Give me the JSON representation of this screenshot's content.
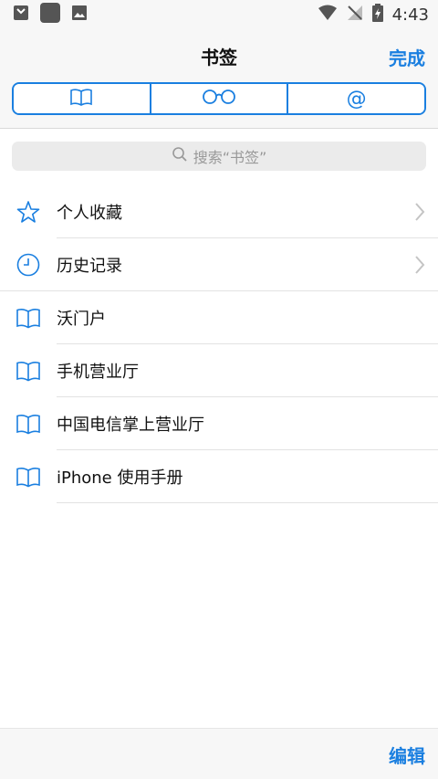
{
  "status_bar": {
    "time": "4:43"
  },
  "header": {
    "title": "书签",
    "done_label": "完成"
  },
  "tabs": [
    {
      "icon": "book-icon"
    },
    {
      "icon": "glasses-icon"
    },
    {
      "icon": "at-icon",
      "symbol": "@"
    }
  ],
  "search": {
    "placeholder": "搜索“书签”"
  },
  "bookmarks": [
    {
      "label": "个人收藏",
      "icon": "star-icon",
      "has_chevron": true
    },
    {
      "label": "历史记录",
      "icon": "clock-icon",
      "has_chevron": true
    },
    {
      "label": "沃门户",
      "icon": "book-icon"
    },
    {
      "label": "手机营业厅",
      "icon": "book-icon"
    },
    {
      "label": "中国电信掌上营业厅",
      "icon": "book-icon"
    },
    {
      "label": "iPhone 使用手册",
      "icon": "book-icon"
    }
  ],
  "toolbar": {
    "edit_label": "编辑"
  },
  "colors": {
    "accent": "#1a7fe0"
  }
}
